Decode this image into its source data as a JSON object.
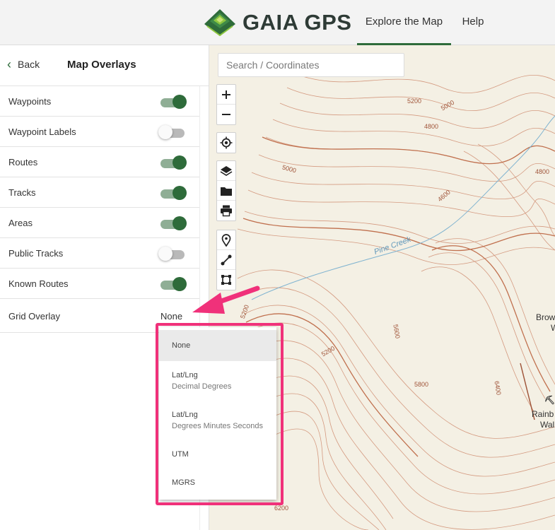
{
  "header": {
    "brand": "GAIA GPS",
    "nav": [
      {
        "label": "Explore the Map",
        "active": true
      },
      {
        "label": "Help",
        "active": false
      }
    ]
  },
  "sidebar": {
    "back_label": "Back",
    "title": "Map Overlays",
    "items": [
      {
        "label": "Waypoints",
        "on": true
      },
      {
        "label": "Waypoint Labels",
        "on": false
      },
      {
        "label": "Routes",
        "on": true
      },
      {
        "label": "Tracks",
        "on": true
      },
      {
        "label": "Areas",
        "on": true
      },
      {
        "label": "Public Tracks",
        "on": false
      },
      {
        "label": "Known Routes",
        "on": true
      }
    ],
    "grid_overlay": {
      "label": "Grid Overlay",
      "value": "None"
    }
  },
  "map": {
    "search_placeholder": "Search / Coordinates",
    "labels": {
      "c5200_top": "5200",
      "c5000_top": "5000",
      "c4800_top": "4800",
      "c5000_left": "5000",
      "c4600": "4600",
      "c4800_right": "4800",
      "creek": "Pine Creek",
      "c5200_left": "5200",
      "c5200_mid": "5200",
      "c5600": "5600",
      "c5800": "5800",
      "c6400": "6400",
      "c6200": "6200"
    },
    "places": {
      "brow_1": "Brow",
      "brow_2": "W",
      "rainbow_1": "Rainb",
      "rainbow_2": "Wal"
    }
  },
  "dropdown": {
    "options": [
      {
        "label": "None",
        "sub": "",
        "selected": true
      },
      {
        "label": "Lat/Lng",
        "sub": "Decimal Degrees",
        "selected": false
      },
      {
        "label": "Lat/Lng",
        "sub": "Degrees Minutes Seconds",
        "selected": false
      },
      {
        "label": "UTM",
        "sub": "",
        "selected": false
      },
      {
        "label": "MGRS",
        "sub": "",
        "selected": false
      }
    ]
  },
  "colors": {
    "accent_green": "#2e6b3a",
    "highlight_pink": "#f0317a",
    "contour": "#c9866a",
    "water": "#6fa8c9"
  }
}
